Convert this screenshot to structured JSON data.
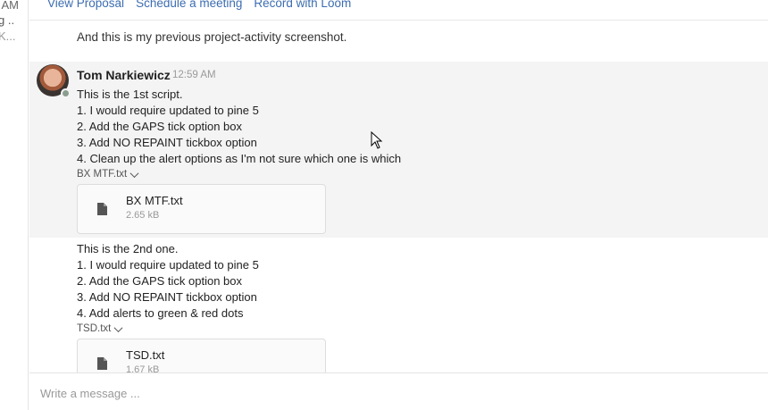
{
  "sidebar": {
    "time": "AM",
    "snippet1": "g ..",
    "snippet2": "K..."
  },
  "actions": {
    "view_proposal": "View Proposal",
    "schedule_meeting": "Schedule a meeting",
    "record_loom": "Record with Loom"
  },
  "previous_message": "And this is my previous project-activity screenshot.",
  "message": {
    "author": "Tom Narkiewicz",
    "time": "12:59 AM",
    "avatar_icon": "user-avatar-photo",
    "block1": {
      "lines": [
        "This is the 1st script.",
        "1. I would require updated to pine 5",
        "2. Add the GAPS tick option box",
        "3. Add NO REPAINT tickbox option",
        "4. Clean up the alert options as I'm not sure which one is which"
      ],
      "file_label": "BX MTF.txt",
      "file_name": "BX MTF.txt",
      "file_size": "2.65 kB"
    },
    "block2": {
      "lines": [
        "This is the 2nd one.",
        "1. I would require updated to pine 5",
        "2. Add the GAPS tick option box",
        "3. Add NO REPAINT tickbox option",
        "4. Add alerts to green & red dots"
      ],
      "file_label": "TSD.txt",
      "file_name": "TSD.txt",
      "file_size": "1.67 kB"
    }
  },
  "composer": {
    "placeholder": "Write a message ..."
  },
  "colors": {
    "link": "#3c6db0",
    "highlight": "#f4f4f4",
    "status_dot": "#8a9e8f"
  }
}
